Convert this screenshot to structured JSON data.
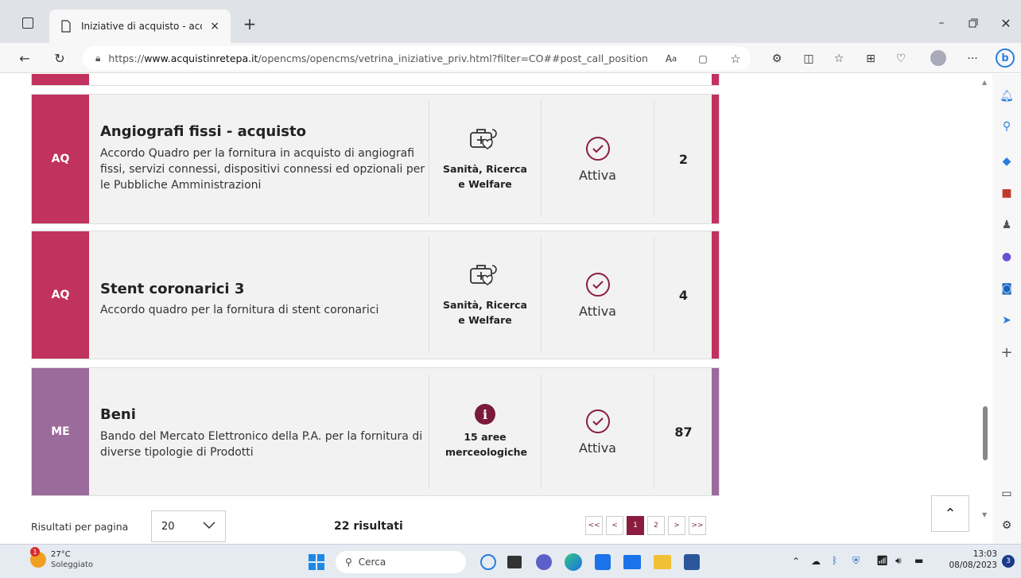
{
  "browser": {
    "tab_title": "Iniziative di acquisto - acqu",
    "url_prefix": "https://",
    "url_domain": "www.acquistinretepa.it",
    "url_path": "/opencms/opencms/vetrina_iniziative_priv.html?filter=CO##post_call_position",
    "new_tab": "+",
    "close": "×"
  },
  "rows": [
    {
      "tag": "AQ",
      "title": "Angiografi fissi - acquisto",
      "description": "Accordo Quadro per la fornitura in acquisto di angiografi fissi, servizi connessi, dispositivi connessi ed opzionali per le Pubbliche Amministrazioni",
      "category": "Sanità, Ricerca e Welfare",
      "status": "Attiva",
      "count": "2",
      "color": "#c1325f"
    },
    {
      "tag": "AQ",
      "title": "Stent coronarici 3",
      "description": "Accordo quadro per la fornitura di stent coronarici",
      "category": "Sanità, Ricerca e Welfare",
      "status": "Attiva",
      "count": "4",
      "color": "#c1325f"
    },
    {
      "tag": "ME",
      "title": "Beni",
      "description": "Bando del Mercato Elettronico della P.A. per la fornitura di diverse tipologie di Prodotti",
      "category": "15 aree merceologiche",
      "status": "Attiva",
      "count": "87",
      "color": "#9b6b9b"
    }
  ],
  "footer": {
    "per_page_label": "Risultati per pagina",
    "per_page_value": "20",
    "results": "22 risultati",
    "pager": [
      "<<",
      "<",
      "1",
      "2",
      ">",
      ">>"
    ]
  },
  "taskbar": {
    "temp": "27°C",
    "weather": "Soleggiato",
    "search": "Cerca",
    "time": "13:03",
    "date": "08/08/2023",
    "notif_count": "3",
    "weather_badge": "1"
  }
}
